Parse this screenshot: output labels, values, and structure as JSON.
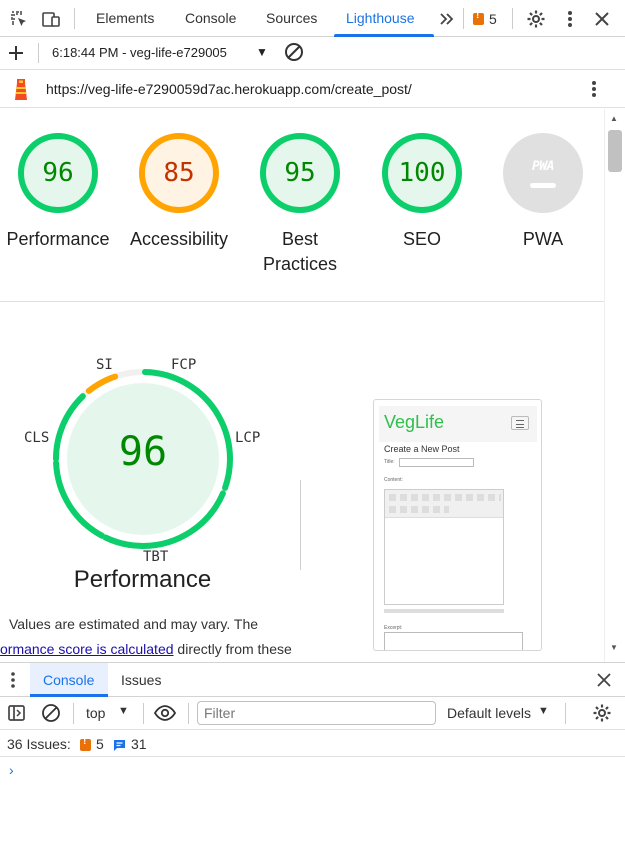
{
  "devtools": {
    "tabs": [
      {
        "label": "Elements"
      },
      {
        "label": "Console"
      },
      {
        "label": "Sources"
      },
      {
        "label": "Lighthouse"
      }
    ],
    "active_tab": "Lighthouse",
    "issues_badge": "5"
  },
  "lighthouse_bar": {
    "report_selector": "6:18:44 PM - veg-life-e729005",
    "url": "https://veg-life-e7290059d7ac.herokuapp.com/create_post/"
  },
  "scores": [
    {
      "label": "Performance",
      "value": "96",
      "status": "pass"
    },
    {
      "label": "Accessibility",
      "value": "85",
      "status": "average"
    },
    {
      "label": "Best\nPractices",
      "value": "95",
      "status": "pass"
    },
    {
      "label": "SEO",
      "value": "100",
      "status": "pass"
    },
    {
      "label": "PWA",
      "value": "PWA",
      "status": "na"
    }
  ],
  "performance": {
    "score": "96",
    "title": "Performance",
    "metrics": [
      "SI",
      "FCP",
      "LCP",
      "TBT",
      "CLS"
    ],
    "note_line1": "Values are estimated and may vary. The",
    "note_link": "ormance score is calculated",
    "note_line2_rest": " directly from these"
  },
  "screenshot": {
    "logo": "VegLife",
    "heading": "Create a New Post",
    "title_label": "Title:",
    "content_label": "Content:",
    "excerpt_label": "Excerpt:"
  },
  "drawer": {
    "tabs": [
      {
        "label": "Console"
      },
      {
        "label": "Issues"
      }
    ],
    "context": "top",
    "filter_placeholder": "Filter",
    "levels": "Default levels",
    "issues_label": "36 Issues:",
    "issues_warn": "5",
    "issues_info": "31"
  },
  "colors": {
    "pass": "#0cce6b",
    "average": "#ffa400",
    "accent": "#1a73e8"
  }
}
